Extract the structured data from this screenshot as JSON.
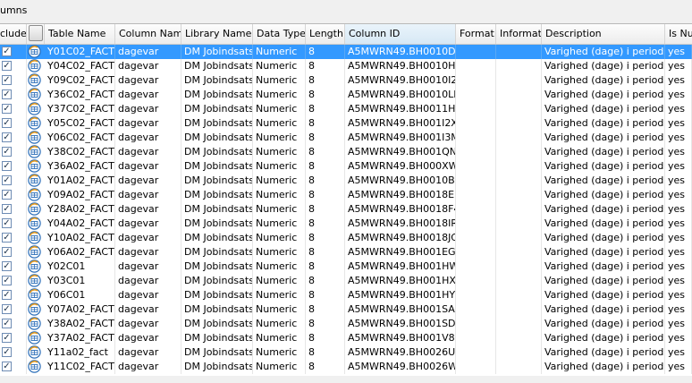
{
  "section_title": "umns",
  "headers": {
    "include": "clude",
    "table_name": "Table Name",
    "column_name": "Column Name",
    "library_name": "Library Name",
    "data_type": "Data Type",
    "length": "Length",
    "column_id": "Column ID",
    "format": "Format",
    "informat": "Informat",
    "description": "Description",
    "is_nullable": "Is Nu"
  },
  "rows": [
    {
      "checked": true,
      "table": "Y01C02_FACT",
      "column": "dagevar",
      "library": "DM Jobindsats",
      "type": "Numeric",
      "length": "8",
      "id": "A5MWRN49.BH0010DV",
      "format": "",
      "informat": "",
      "desc": "Varighed (dage) i perioden",
      "nullable": "yes",
      "selected": true
    },
    {
      "checked": true,
      "table": "Y04C02_FACT",
      "column": "dagevar",
      "library": "DM Jobindsats",
      "type": "Numeric",
      "length": "8",
      "id": "A5MWRN49.BH0010HH",
      "format": "",
      "informat": "",
      "desc": "Varighed (dage) i perioden",
      "nullable": "yes"
    },
    {
      "checked": true,
      "table": "Y09C02_FACT",
      "column": "dagevar",
      "library": "DM Jobindsats",
      "type": "Numeric",
      "length": "8",
      "id": "A5MWRN49.BH0010I2",
      "format": "",
      "informat": "",
      "desc": "Varighed (dage) i perioden",
      "nullable": "yes"
    },
    {
      "checked": true,
      "table": "Y36C02_FACT",
      "column": "dagevar",
      "library": "DM Jobindsats",
      "type": "Numeric",
      "length": "8",
      "id": "A5MWRN49.BH0010LB",
      "format": "",
      "informat": "",
      "desc": "Varighed (dage) i perioden",
      "nullable": "yes"
    },
    {
      "checked": true,
      "table": "Y37C02_FACT",
      "column": "dagevar",
      "library": "DM Jobindsats",
      "type": "Numeric",
      "length": "8",
      "id": "A5MWRN49.BH0011H2",
      "format": "",
      "informat": "",
      "desc": "Varighed (dage) i perioden",
      "nullable": "yes"
    },
    {
      "checked": true,
      "table": "Y05C02_FACT",
      "column": "dagevar",
      "library": "DM Jobindsats",
      "type": "Numeric",
      "length": "8",
      "id": "A5MWRN49.BH001I2X",
      "format": "",
      "informat": "",
      "desc": "Varighed (dage) i perioden",
      "nullable": "yes"
    },
    {
      "checked": true,
      "table": "Y06C02_FACT",
      "column": "dagevar",
      "library": "DM Jobindsats",
      "type": "Numeric",
      "length": "8",
      "id": "A5MWRN49.BH001I3M",
      "format": "",
      "informat": "",
      "desc": "Varighed (dage) i perioden",
      "nullable": "yes"
    },
    {
      "checked": true,
      "table": "Y38C02_FACT",
      "column": "dagevar",
      "library": "DM Jobindsats",
      "type": "Numeric",
      "length": "8",
      "id": "A5MWRN49.BH001QNP",
      "format": "",
      "informat": "",
      "desc": "Varighed (dage) i perioden",
      "nullable": "yes"
    },
    {
      "checked": true,
      "table": "Y36A02_FACT",
      "column": "dagevar",
      "library": "DM Jobindsats",
      "type": "Numeric",
      "length": "8",
      "id": "A5MWRN49.BH000XWH",
      "format": "",
      "informat": "",
      "desc": "Varighed (dage) i perioden",
      "nullable": "yes"
    },
    {
      "checked": true,
      "table": "Y01A02_FACT",
      "column": "dagevar",
      "library": "DM Jobindsats",
      "type": "Numeric",
      "length": "8",
      "id": "A5MWRN49.BH0010B3",
      "format": "",
      "informat": "",
      "desc": "Varighed (dage) i perioden",
      "nullable": "yes"
    },
    {
      "checked": true,
      "table": "Y09A02_FACT",
      "column": "dagevar",
      "library": "DM Jobindsats",
      "type": "Numeric",
      "length": "8",
      "id": "A5MWRN49.BH0018EF",
      "format": "",
      "informat": "",
      "desc": "Varighed (dage) i perioden",
      "nullable": "yes"
    },
    {
      "checked": true,
      "table": "Y28A02_FACT",
      "column": "dagevar",
      "library": "DM Jobindsats",
      "type": "Numeric",
      "length": "8",
      "id": "A5MWRN49.BH0018F4",
      "format": "",
      "informat": "",
      "desc": "Varighed (dage) i perioden",
      "nullable": "yes"
    },
    {
      "checked": true,
      "table": "Y04A02_FACT",
      "column": "dagevar",
      "library": "DM Jobindsats",
      "type": "Numeric",
      "length": "8",
      "id": "A5MWRN49.BH0018IR",
      "format": "",
      "informat": "",
      "desc": "Varighed (dage) i perioden",
      "nullable": "yes"
    },
    {
      "checked": true,
      "table": "Y10A02_FACT",
      "column": "dagevar",
      "library": "DM Jobindsats",
      "type": "Numeric",
      "length": "8",
      "id": "A5MWRN49.BH0018JG",
      "format": "",
      "informat": "",
      "desc": "Varighed (dage) i perioden",
      "nullable": "yes"
    },
    {
      "checked": true,
      "table": "Y06A02_FACT",
      "column": "dagevar",
      "library": "DM Jobindsats",
      "type": "Numeric",
      "length": "8",
      "id": "A5MWRN49.BH001EGN",
      "format": "",
      "informat": "",
      "desc": "Varighed (dage) i perioden",
      "nullable": "yes"
    },
    {
      "checked": true,
      "table": "Y02C01",
      "column": "dagevar",
      "library": "DM Jobindsats",
      "type": "Numeric",
      "length": "8",
      "id": "A5MWRN49.BH001HWE",
      "format": "",
      "informat": "",
      "desc": "Varighed (dage) i perioden",
      "nullable": "yes"
    },
    {
      "checked": true,
      "table": "Y03C01",
      "column": "dagevar",
      "library": "DM Jobindsats",
      "type": "Numeric",
      "length": "8",
      "id": "A5MWRN49.BH001HXA",
      "format": "",
      "informat": "",
      "desc": "Varighed (dage) i perioden",
      "nullable": "yes"
    },
    {
      "checked": true,
      "table": "Y06C01",
      "column": "dagevar",
      "library": "DM Jobindsats",
      "type": "Numeric",
      "length": "8",
      "id": "A5MWRN49.BH001HY6",
      "format": "",
      "informat": "",
      "desc": "Varighed (dage) i perioden",
      "nullable": "yes"
    },
    {
      "checked": true,
      "table": "Y07A02_FACT",
      "column": "dagevar",
      "library": "DM Jobindsats",
      "type": "Numeric",
      "length": "8",
      "id": "A5MWRN49.BH001SA1",
      "format": "",
      "informat": "",
      "desc": "Varighed (dage) i perioden",
      "nullable": "yes"
    },
    {
      "checked": true,
      "table": "Y38A02_FACT",
      "column": "dagevar",
      "library": "DM Jobindsats",
      "type": "Numeric",
      "length": "8",
      "id": "A5MWRN49.BH001SDM",
      "format": "",
      "informat": "",
      "desc": "Varighed (dage) i perioden",
      "nullable": "yes"
    },
    {
      "checked": true,
      "table": "Y37A02_FACT",
      "column": "dagevar",
      "library": "DM Jobindsats",
      "type": "Numeric",
      "length": "8",
      "id": "A5MWRN49.BH001V8B",
      "format": "",
      "informat": "",
      "desc": "Varighed (dage) i perioden",
      "nullable": "yes"
    },
    {
      "checked": true,
      "table": "Y11a02_fact",
      "column": "dagevar",
      "library": "DM Jobindsats",
      "type": "Numeric",
      "length": "8",
      "id": "A5MWRN49.BH0026UT",
      "format": "",
      "informat": "",
      "desc": "Varighed (dage) i perioden",
      "nullable": "yes"
    },
    {
      "checked": true,
      "table": "Y11C02_FACT",
      "column": "dagevar",
      "library": "DM Jobindsats",
      "type": "Numeric",
      "length": "8",
      "id": "A5MWRN49.BH0026WI",
      "format": "",
      "informat": "",
      "desc": "Varighed (dage) i perioden",
      "nullable": "yes"
    }
  ],
  "icons": {
    "table_icon": "sas-table-icon",
    "select_all": "select-all-button"
  },
  "colors": {
    "selected_row": "#3399ff",
    "active_header": "#d6e8f5"
  }
}
